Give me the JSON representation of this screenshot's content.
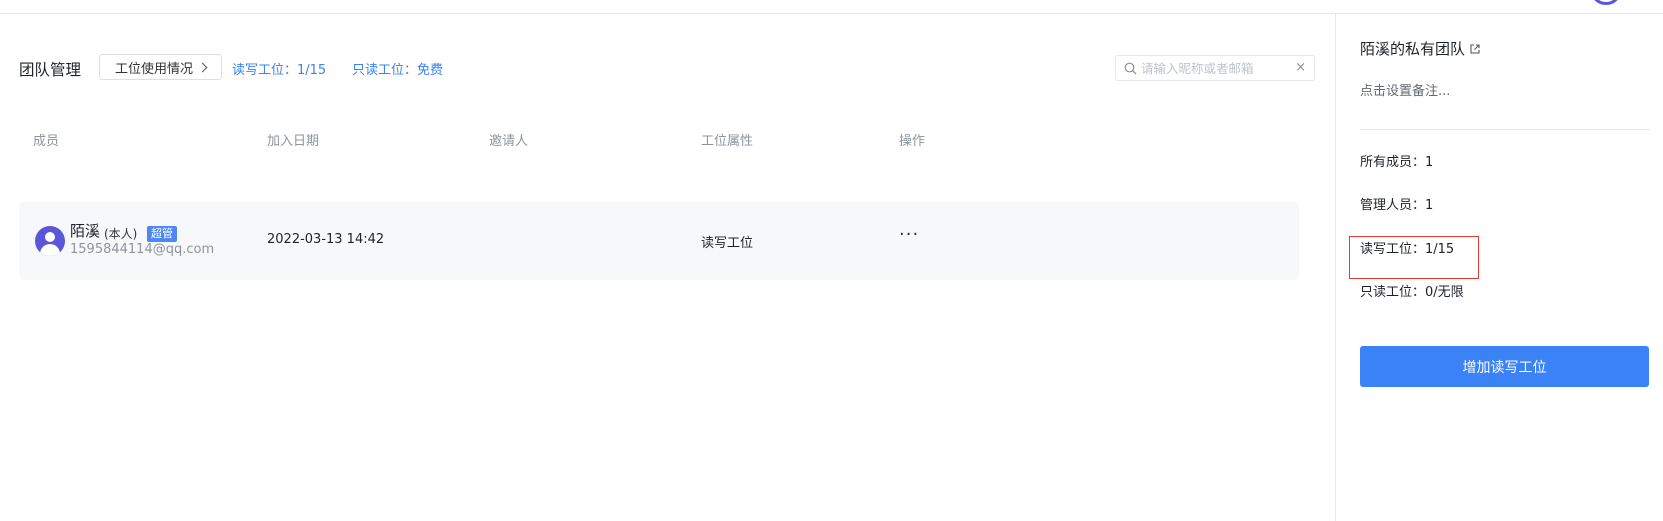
{
  "header": {
    "title": "团队管理",
    "usage_button": "工位使用情况",
    "rw_seats_link": "读写工位：1/15",
    "ro_seats_link": "只读工位：免费"
  },
  "search": {
    "placeholder": "请输入昵称或者邮箱",
    "value": "",
    "clear_icon": "×"
  },
  "table": {
    "columns": [
      "成员",
      "加入日期",
      "邀请人",
      "工位属性",
      "操作"
    ],
    "rows": [
      {
        "name": "陌溪",
        "self_tag": "(本人)",
        "role_badge": "超管",
        "email": "1595844114@qq.com",
        "join_date": "2022-03-13 14:42",
        "inviter": "",
        "seat_type": "读写工位",
        "actions": "···"
      }
    ]
  },
  "sidebar": {
    "team_name": "陌溪的私有团队",
    "remark_placeholder": "点击设置备注...",
    "stats": {
      "all_members": "所有成员：1",
      "admins": "管理人员：1",
      "rw_seats": "读写工位：1/15",
      "ro_seats": "只读工位：0/无限"
    },
    "add_button": "增加读写工位"
  },
  "colors": {
    "accent": "#3a82f6",
    "avatar": "#5b55d9",
    "highlight_border": "#e53935",
    "row_background": "#f7f8fa"
  }
}
